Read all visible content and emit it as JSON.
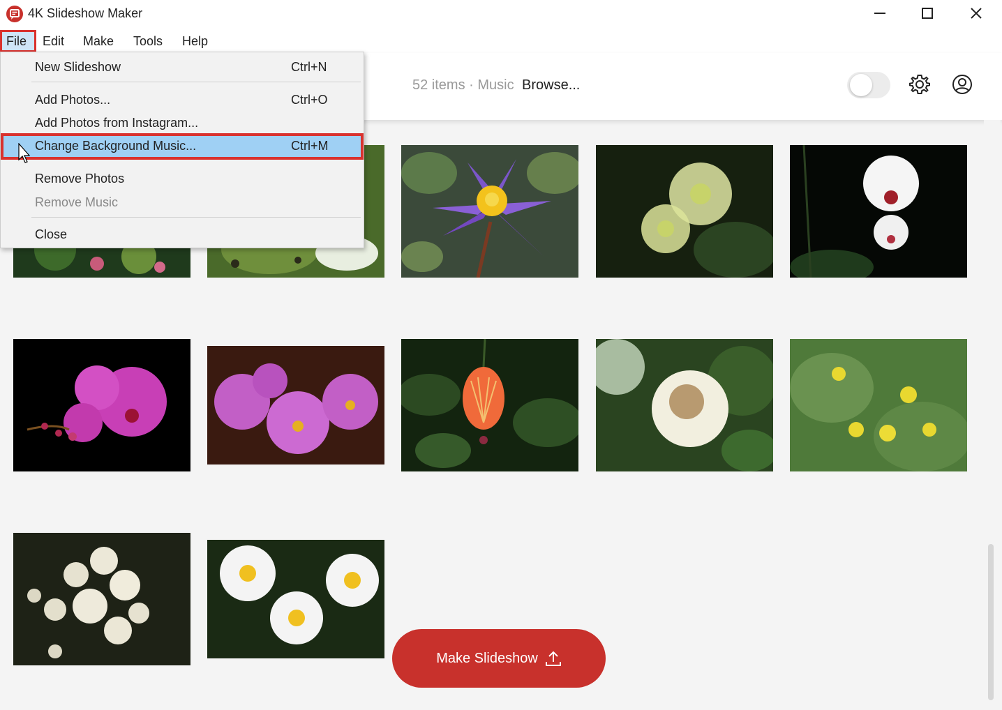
{
  "window": {
    "title": "4K Slideshow Maker"
  },
  "menubar": {
    "items": [
      {
        "label": "File"
      },
      {
        "label": "Edit"
      },
      {
        "label": "Make"
      },
      {
        "label": "Tools"
      },
      {
        "label": "Help"
      }
    ]
  },
  "header": {
    "status": "52 items · Music",
    "browse_label": "Browse..."
  },
  "file_menu": {
    "items": [
      {
        "label": "New Slideshow",
        "shortcut": "Ctrl+N"
      },
      {
        "label": "Add Photos...",
        "shortcut": "Ctrl+O"
      },
      {
        "label": "Add Photos from Instagram...",
        "shortcut": ""
      },
      {
        "label": "Change Background Music...",
        "shortcut": "Ctrl+M"
      },
      {
        "label": "Remove Photos",
        "shortcut": ""
      },
      {
        "label": "Remove Music",
        "shortcut": ""
      },
      {
        "label": "Close",
        "shortcut": ""
      }
    ]
  },
  "footer": {
    "make_label": "Make Slideshow"
  },
  "colors": {
    "accent": "#c8312c",
    "highlight": "#9fd0f4",
    "outline": "#d9322e"
  }
}
